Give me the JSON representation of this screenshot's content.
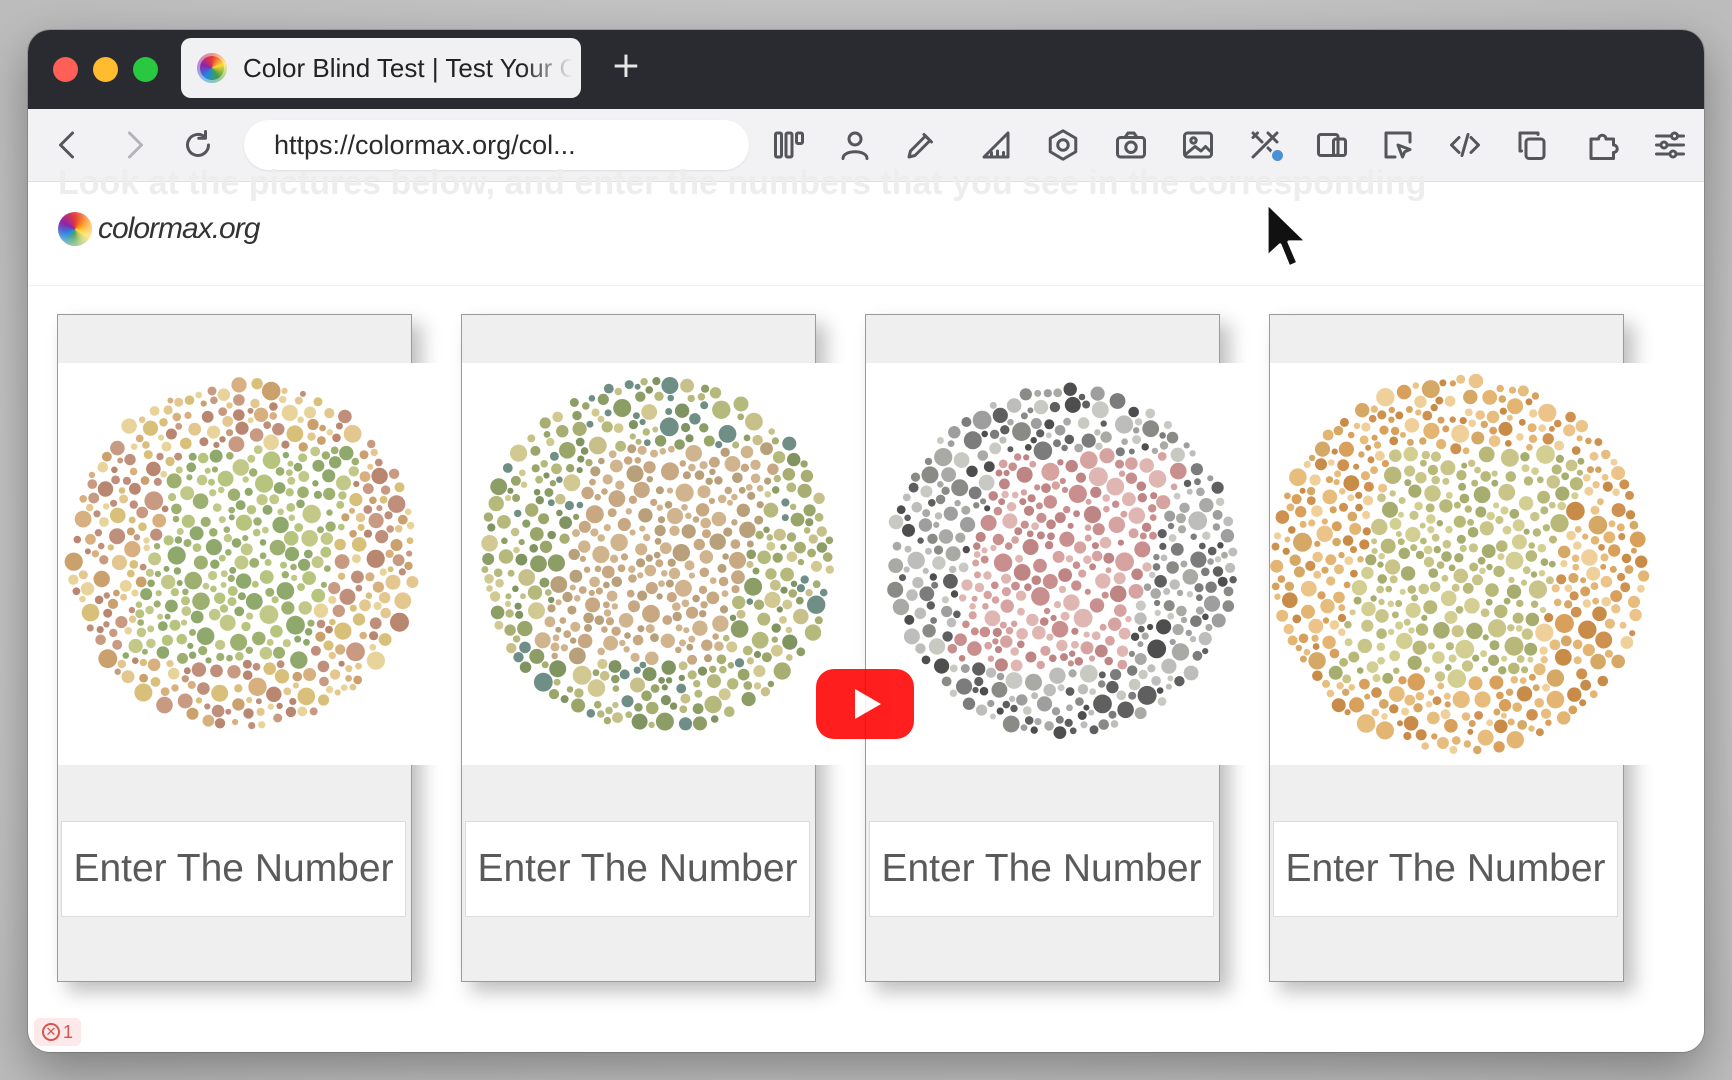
{
  "browser": {
    "tab_title": "Color Blind Test | Test Your Color Vision",
    "new_tab_symbol": "+",
    "url": "https://colormax.org/col...",
    "extension_badge_color": "#4a90d9"
  },
  "page": {
    "ghost_heading": "Look at the pictures below, and enter the numbers that you see in the corresponding",
    "logo_text": "colormax.org",
    "plates": [
      {
        "placeholder": "Enter The Number",
        "palette": [
          "#c99a82",
          "#d8b080",
          "#b98670",
          "#e4c78e",
          "#caa06c",
          "#d9c07a",
          "#bf8f7c",
          "#e8d49a"
        ],
        "figure_palette": [
          "#9db070",
          "#b7c47e",
          "#8fa96c",
          "#c2c988"
        ]
      },
      {
        "placeholder": "Enter The Number",
        "palette": [
          "#9aa56a",
          "#b5b97c",
          "#7f9460",
          "#c7c08a",
          "#a8ad72",
          "#8c9d66",
          "#6f8f86",
          "#d1c991"
        ],
        "figure_palette": [
          "#c7a882",
          "#d0b48e",
          "#b8a07a"
        ]
      },
      {
        "placeholder": "Enter The Number",
        "palette": [
          "#9e9e9e",
          "#7c7c7c",
          "#bdbdbb",
          "#5f5f5f",
          "#a9a9a6",
          "#c9c9c4",
          "#8a8a86",
          "#4e4e4e"
        ],
        "figure_palette": [
          "#c98f8f",
          "#d7a3a1",
          "#bf8484",
          "#e0b6b3"
        ]
      },
      {
        "placeholder": "Enter The Number",
        "palette": [
          "#e3b472",
          "#d9a05c",
          "#ecc48a",
          "#cf9150",
          "#e7bd7e",
          "#d6a866",
          "#f0d09a",
          "#c98b48"
        ],
        "figure_palette": [
          "#b8b878",
          "#c9c488",
          "#a7ad6e",
          "#d3cf93"
        ]
      }
    ],
    "video_play_color": "#ff0000",
    "error_count": "1"
  }
}
